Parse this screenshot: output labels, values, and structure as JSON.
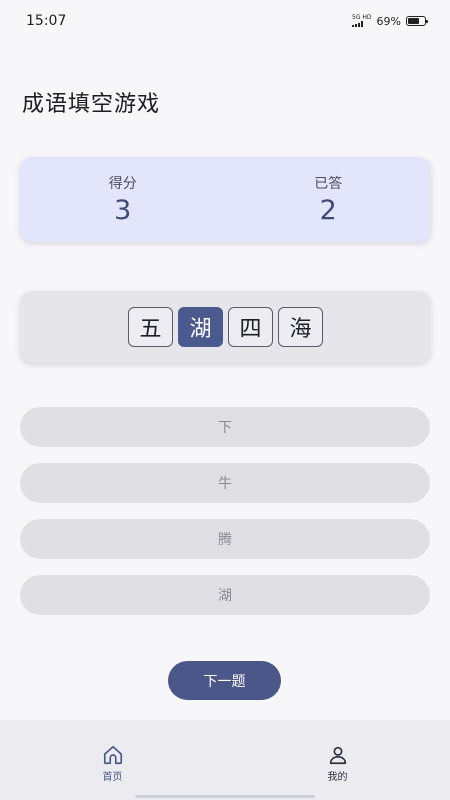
{
  "status_bar": {
    "time": "15:07",
    "network": "5G HD",
    "battery_percent": "69%",
    "battery_level": 0.69
  },
  "title": "成语填空游戏",
  "score": {
    "score_label": "得分",
    "score_value": "3",
    "answered_label": "已答",
    "answered_value": "2"
  },
  "idiom": {
    "chars": [
      "五",
      "湖",
      "四",
      "海"
    ],
    "highlight_index": 1
  },
  "options": [
    "下",
    "牛",
    "腾",
    "湖"
  ],
  "next_button_label": "下一题",
  "bottom_nav": {
    "items": [
      {
        "label": "首页",
        "icon": "home-icon",
        "active": true
      },
      {
        "label": "我的",
        "icon": "user-icon",
        "active": false
      }
    ]
  },
  "colors": {
    "accent": "#4a5788",
    "score_card_bg": "#e3e5fb",
    "highlight_char_bg": "#4a5a8f"
  }
}
